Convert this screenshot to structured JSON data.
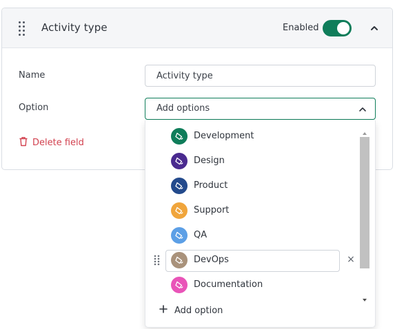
{
  "card": {
    "title": "Activity type",
    "enabled_label": "Enabled",
    "enabled": true
  },
  "fields": {
    "name_label": "Name",
    "name_value": "Activity type",
    "option_label": "Option",
    "option_placeholder": "Add options",
    "delete_label": "Delete field"
  },
  "dropdown": {
    "options": [
      {
        "label": "Development",
        "color": "#0f7d5a"
      },
      {
        "label": "Design",
        "color": "#4a2a8f"
      },
      {
        "label": "Product",
        "color": "#234a8c"
      },
      {
        "label": "Support",
        "color": "#f0a53c"
      },
      {
        "label": "QA",
        "color": "#5c9fe6"
      },
      {
        "label": "DevOps",
        "color": "#a9927b"
      },
      {
        "label": "Documentation",
        "color": "#e954b8"
      }
    ],
    "editing_index": 5,
    "add_option_label": "Add option"
  },
  "colors": {
    "accent": "#0f7d5a",
    "danger": "#d2414f"
  }
}
